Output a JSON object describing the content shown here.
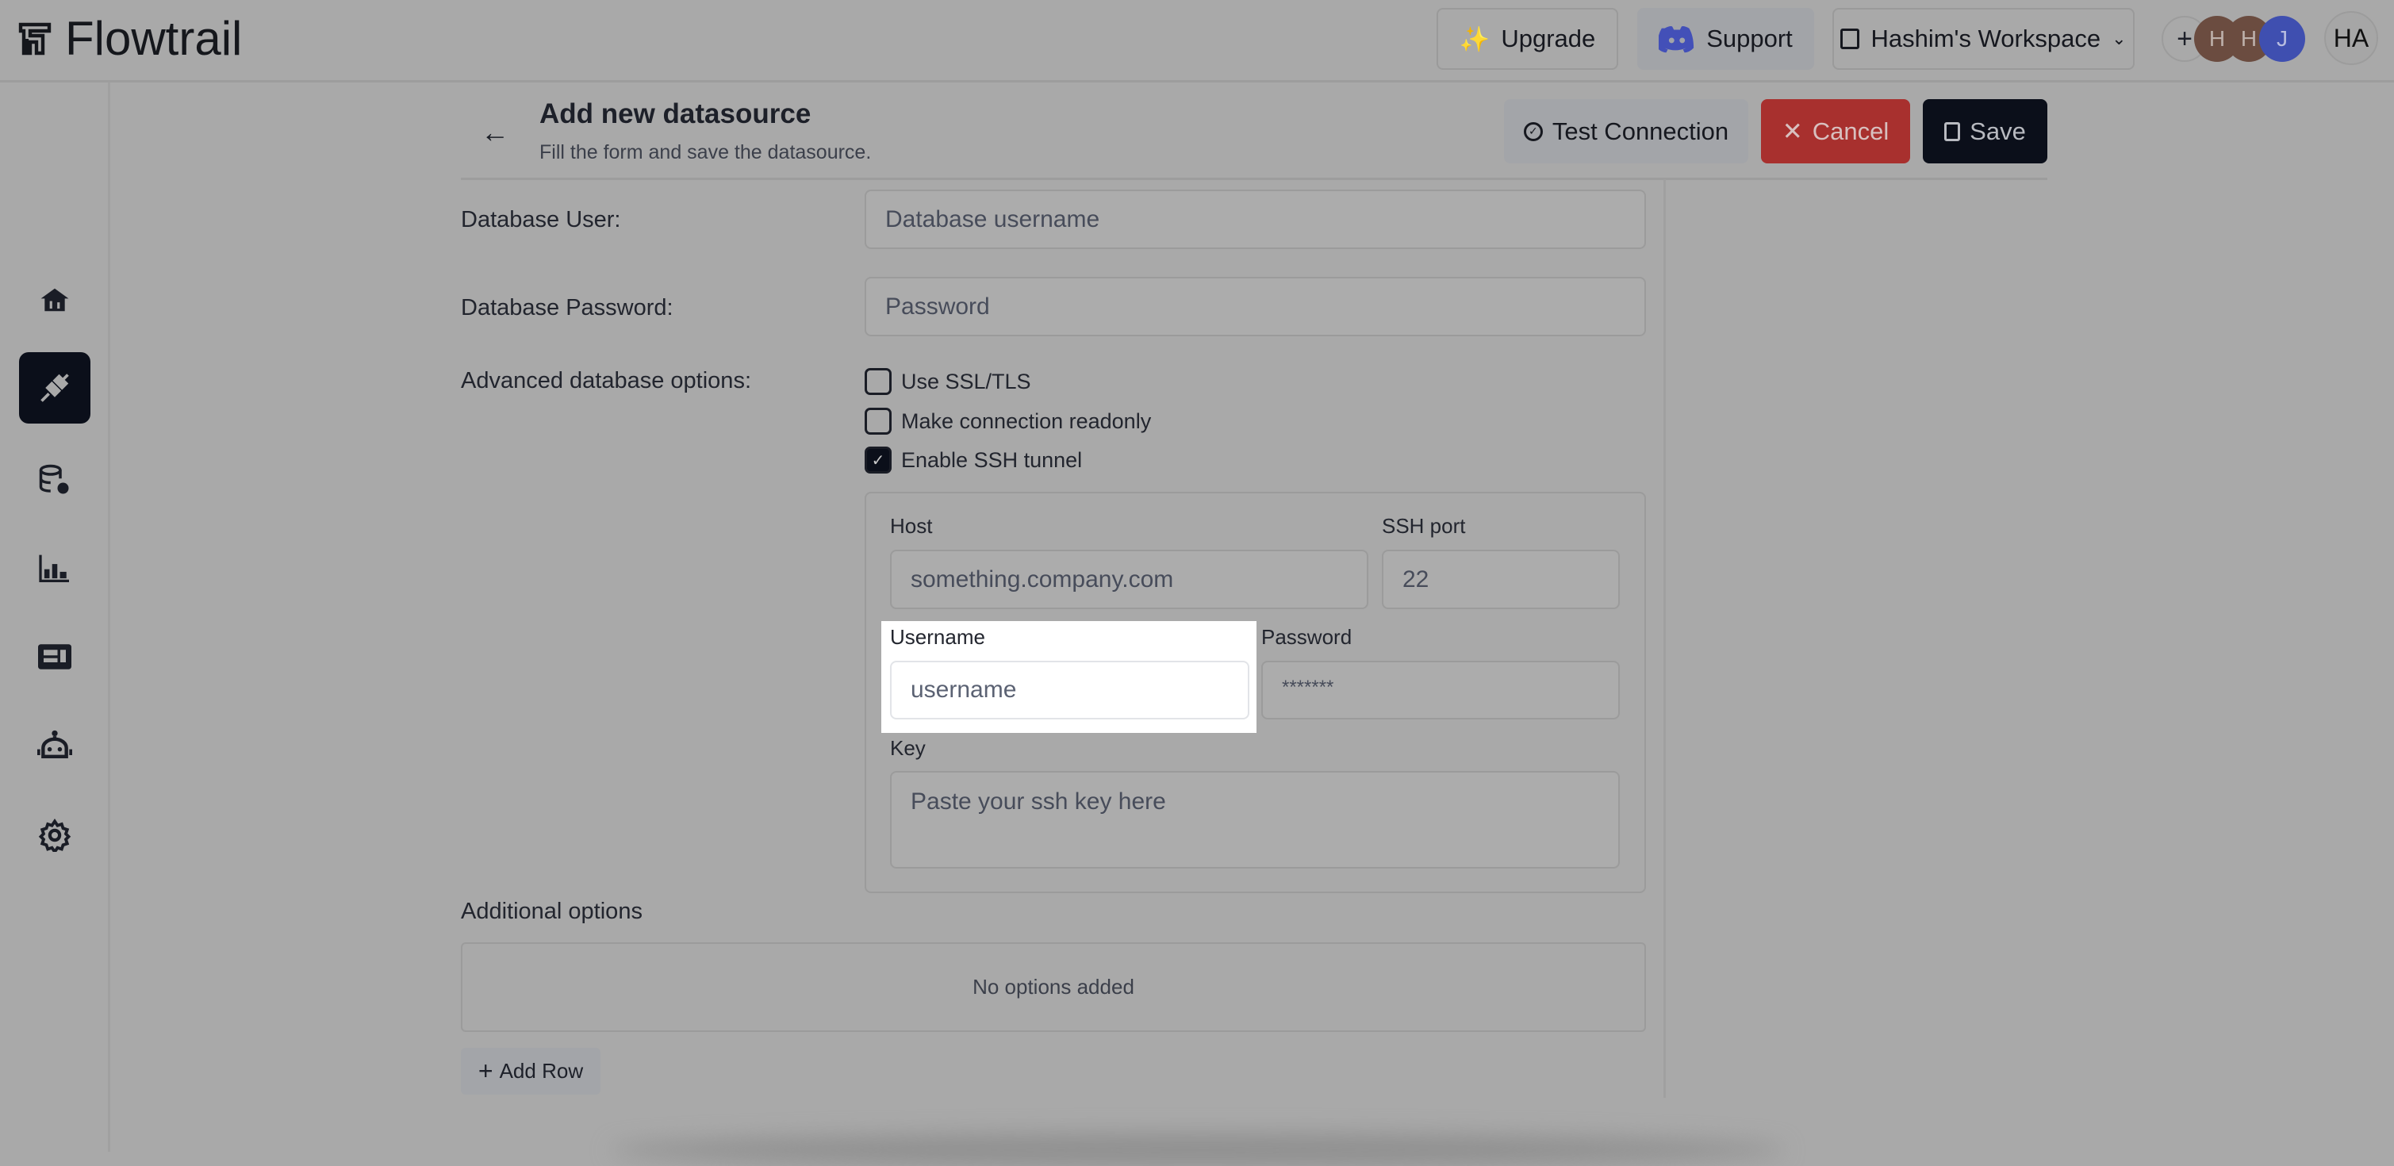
{
  "app": {
    "name": "Flowtrail"
  },
  "topbar": {
    "upgrade_label": "Upgrade",
    "support_label": "Support",
    "workspace_label": "Hashim's Workspace",
    "add_member_label": "+",
    "members": [
      {
        "initial": "H",
        "color": "#6b4c40"
      },
      {
        "initial": "H",
        "color": "#6b4c40"
      },
      {
        "initial": "J",
        "color": "#3f4fb0"
      }
    ],
    "user_initials": "HA"
  },
  "sidebar": {
    "items": [
      {
        "icon": "home-icon",
        "active": false
      },
      {
        "icon": "plug-icon",
        "active": true
      },
      {
        "icon": "database-settings-icon",
        "active": false
      },
      {
        "icon": "bar-chart-icon",
        "active": false
      },
      {
        "icon": "dashboard-icon",
        "active": false
      },
      {
        "icon": "robot-icon",
        "active": false
      },
      {
        "icon": "gear-icon",
        "active": false
      }
    ]
  },
  "header": {
    "title": "Add new datasource",
    "subtitle": "Fill the form and save the datasource.",
    "test_label": "Test Connection",
    "cancel_label": "Cancel",
    "save_label": "Save"
  },
  "form": {
    "db_user_label": "Database User:",
    "db_user_placeholder": "Database username",
    "db_password_label": "Database Password:",
    "db_password_placeholder": "Password",
    "advanced_label": "Advanced database options:",
    "options": [
      {
        "label": "Use SSL/TLS",
        "checked": false
      },
      {
        "label": "Make connection readonly",
        "checked": false
      },
      {
        "label": "Enable SSH tunnel",
        "checked": true
      }
    ],
    "ssh": {
      "host_label": "Host",
      "host_placeholder": "something.company.com",
      "port_label": "SSH port",
      "port_placeholder": "22",
      "username_label": "Username",
      "username_placeholder": "username",
      "password_label": "Password",
      "password_placeholder": "*******",
      "key_label": "Key",
      "key_placeholder": "Paste your ssh key here"
    },
    "additional_label": "Additional options",
    "no_options": "No options added",
    "add_row_label": "Add Row"
  },
  "colors": {
    "cancel": "#a8302e",
    "save": "#0b0f1a",
    "discord": "#4350b8"
  }
}
